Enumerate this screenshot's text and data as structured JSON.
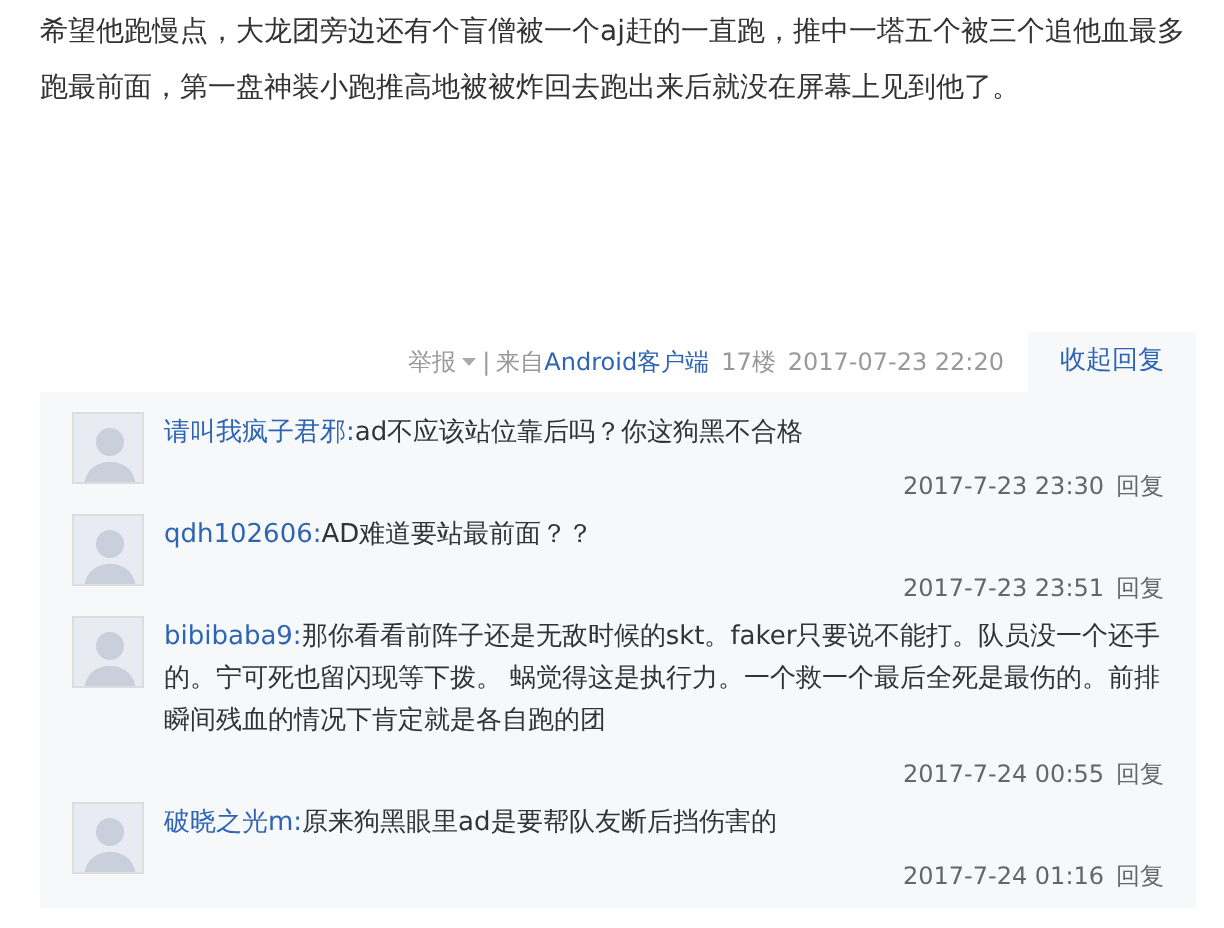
{
  "post": {
    "text": "希望他跑慢点，大龙团旁边还有个盲僧被一个aj赶的一直跑，推中一塔五个被三个追他血最多跑最前面，第一盘神装小跑推高地被被炸回去跑出来后就没在屏幕上见到他了。"
  },
  "meta": {
    "report": "举报",
    "separator": "|",
    "source_prefix": "来自",
    "source": "Android客户端",
    "floor": "17楼",
    "time": "2017-07-23 22:20",
    "toggle": "收起回复"
  },
  "replies": [
    {
      "user": "请叫我疯子君邪:",
      "text": "ad不应该站位靠后吗？你这狗黑不合格",
      "time": "2017-7-23 23:30",
      "reply": "回复"
    },
    {
      "user": "qdh102606:",
      "text": "AD难道要站最前面？？",
      "time": "2017-7-23 23:51",
      "reply": "回复"
    },
    {
      "user": "bibibaba9:",
      "text": "那你看看前阵子还是无敌时候的skt。faker只要说不能打。队员没一个还手的。宁可死也留闪现等下拨。 蜗觉得这是执行力。一个救一个最后全死是最伤的。前排瞬间残血的情况下肯定就是各自跑的团",
      "time": "2017-7-24 00:55",
      "reply": "回复"
    },
    {
      "user": "破晓之光m:",
      "text": "原来狗黑眼里ad是要帮队友断后挡伤害的",
      "time": "2017-7-24 01:16",
      "reply": "回复"
    }
  ]
}
